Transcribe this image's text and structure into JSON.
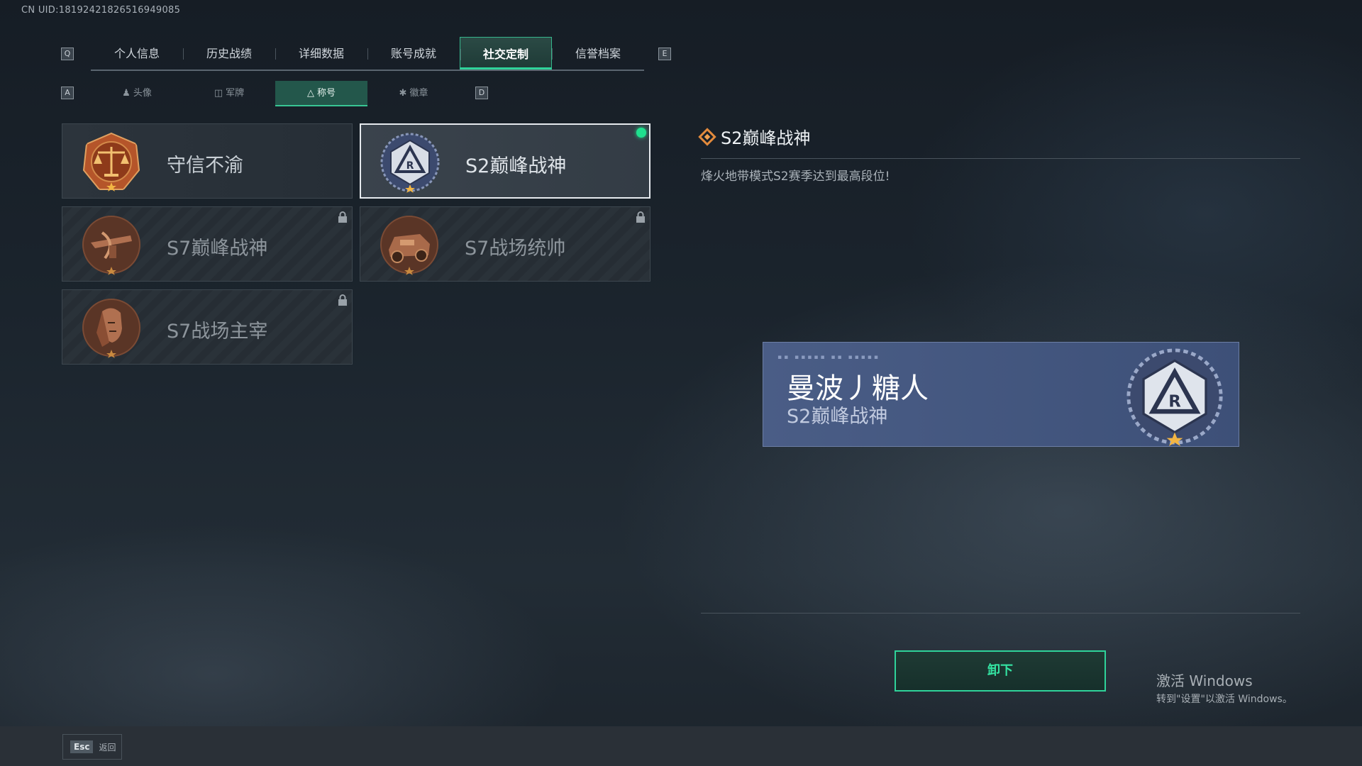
{
  "uid": "CN UID:18192421826516949085",
  "main_tabs": {
    "key_left": "Q",
    "key_right": "E",
    "items": [
      "个人信息",
      "历史战绩",
      "详细数据",
      "账号成就",
      "社交定制",
      "信誉档案"
    ],
    "active_index": 4
  },
  "sub_tabs": {
    "key_left": "A",
    "key_right": "D",
    "items": [
      "头像",
      "军牌",
      "称号",
      "徽章"
    ],
    "active_index": 2
  },
  "titles": [
    {
      "label": "守信不渝",
      "locked": false,
      "selected": false,
      "badge": "scales-icon"
    },
    {
      "label": "S2巅峰战神",
      "locked": false,
      "selected": true,
      "equipped": true,
      "badge": "r-shield-icon"
    },
    {
      "label": "S7巅峰战神",
      "locked": true,
      "selected": false,
      "badge": "crossbow-icon"
    },
    {
      "label": "S7战场统帅",
      "locked": true,
      "selected": false,
      "badge": "vehicle-icon"
    },
    {
      "label": "S7战场主宰",
      "locked": true,
      "selected": false,
      "badge": "warrior-icon"
    }
  ],
  "detail": {
    "title": "S2巅峰战神",
    "description": "烽火地带模式S2赛季达到最高段位!"
  },
  "preview": {
    "player_name": "曼波丿糖人",
    "title": "S2巅峰战神"
  },
  "actions": {
    "unequip_label": "卸下"
  },
  "watermark": {
    "line1": "激活 Windows",
    "line2": "转到\"设置\"以激活 Windows。"
  },
  "footer": {
    "esc_key": "Esc",
    "back_label": "返回"
  },
  "colors": {
    "accent_green": "#2fd39a",
    "equipped_dot": "#1fe08e",
    "preview_bg": "#4a5d86"
  }
}
